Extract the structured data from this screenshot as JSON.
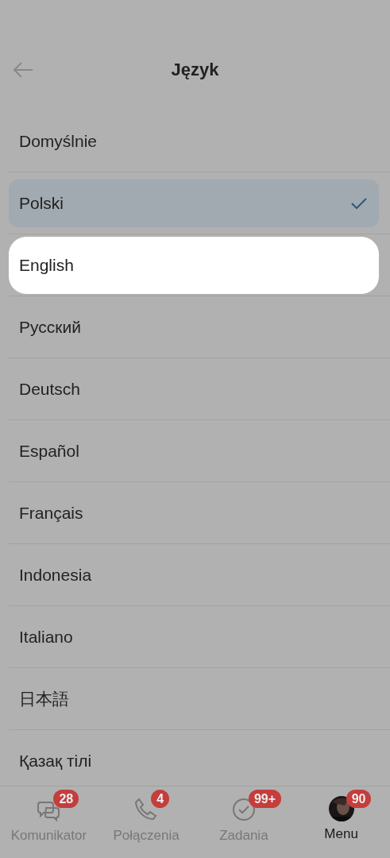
{
  "header": {
    "title": "Język"
  },
  "languages": [
    {
      "label": "Domyślnie",
      "selected": false,
      "highlighted": false
    },
    {
      "label": "Polski",
      "selected": true,
      "highlighted": false
    },
    {
      "label": "English",
      "selected": false,
      "highlighted": true
    },
    {
      "label": "Русский",
      "selected": false,
      "highlighted": false
    },
    {
      "label": "Deutsch",
      "selected": false,
      "highlighted": false
    },
    {
      "label": "Español",
      "selected": false,
      "highlighted": false
    },
    {
      "label": "Français",
      "selected": false,
      "highlighted": false
    },
    {
      "label": "Indonesia",
      "selected": false,
      "highlighted": false
    },
    {
      "label": "Italiano",
      "selected": false,
      "highlighted": false
    },
    {
      "label": "日本語",
      "selected": false,
      "highlighted": false
    },
    {
      "label": "Қазақ тілі",
      "selected": false,
      "highlighted": false
    }
  ],
  "bottom_nav": [
    {
      "kind": "chat",
      "label": "Komunikator",
      "badge": "28",
      "selected": false
    },
    {
      "kind": "phone",
      "label": "Połączenia",
      "badge": "4",
      "selected": false
    },
    {
      "kind": "tasks",
      "label": "Zadania",
      "badge": "99+",
      "selected": false
    },
    {
      "kind": "avatar",
      "label": "Menu",
      "badge": "90",
      "selected": true
    }
  ]
}
